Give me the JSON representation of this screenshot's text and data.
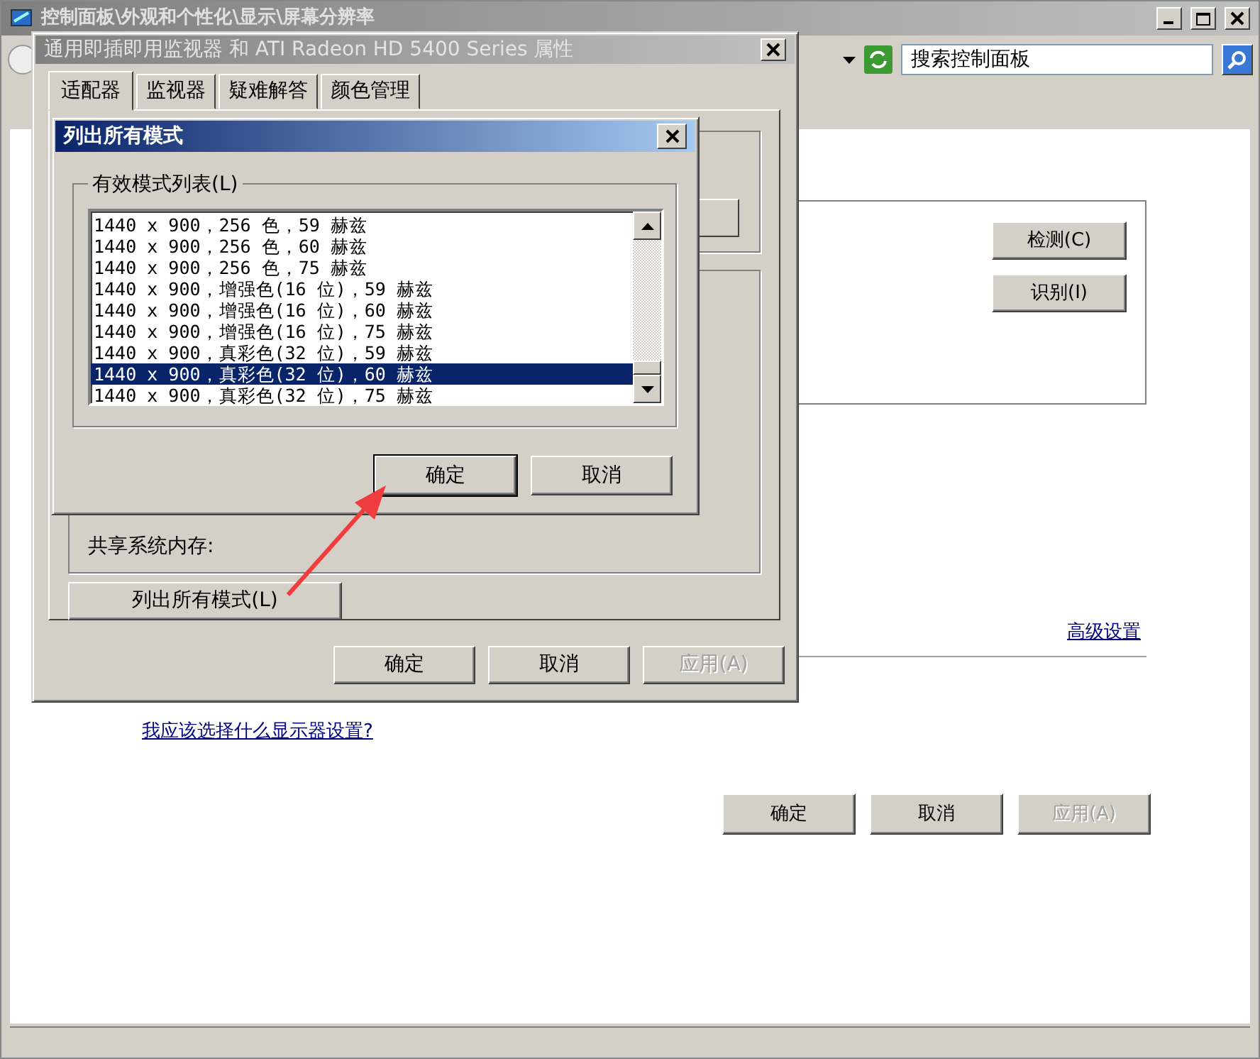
{
  "background_window": {
    "title": "控制面板\\外观和个性化\\显示\\屏幕分辨率",
    "search": {
      "value": "搜索控制面板"
    },
    "detect_buttons": [
      {
        "label": "检测(C)"
      },
      {
        "label": "识别(I)"
      }
    ],
    "advanced_link": "高级设置",
    "help_link": "我应该选择什么显示器设置?",
    "buttons": [
      {
        "label": "确定",
        "disabled": false
      },
      {
        "label": "取消",
        "disabled": false
      },
      {
        "label": "应用(A)",
        "disabled": true
      }
    ]
  },
  "properties_dialog": {
    "title": "通用即插即用监视器 和 ATI Radeon HD 5400 Series 属性",
    "tabs": [
      {
        "label": "适配器",
        "selected": true
      },
      {
        "label": "监视器",
        "selected": false
      },
      {
        "label": "疑难解答",
        "selected": false
      },
      {
        "label": "颜色管理",
        "selected": false
      }
    ],
    "memory_label": "共享系统内存:",
    "list_modes_button": "列出所有模式(L)",
    "buttons": [
      {
        "label": "确定",
        "disabled": false
      },
      {
        "label": "取消",
        "disabled": false
      },
      {
        "label": "应用(A)",
        "disabled": true
      }
    ]
  },
  "modes_dialog": {
    "title": "列出所有模式",
    "group_label": "有效模式列表(L)",
    "modes": [
      {
        "text": "1440 x 900，256 色，59 赫兹",
        "selected": false
      },
      {
        "text": "1440 x 900，256 色，60 赫兹",
        "selected": false
      },
      {
        "text": "1440 x 900，256 色，75 赫兹",
        "selected": false
      },
      {
        "text": "1440 x 900，增强色(16 位)，59 赫兹",
        "selected": false
      },
      {
        "text": "1440 x 900，增强色(16 位)，60 赫兹",
        "selected": false
      },
      {
        "text": "1440 x 900，增强色(16 位)，75 赫兹",
        "selected": false
      },
      {
        "text": "1440 x 900，真彩色(32 位)，59 赫兹",
        "selected": false
      },
      {
        "text": "1440 x 900，真彩色(32 位)，60 赫兹",
        "selected": true
      },
      {
        "text": "1440 x 900，真彩色(32 位)，75 赫兹",
        "selected": false
      }
    ],
    "buttons": [
      {
        "label": "确定",
        "default": true
      },
      {
        "label": "取消",
        "default": false
      }
    ]
  }
}
